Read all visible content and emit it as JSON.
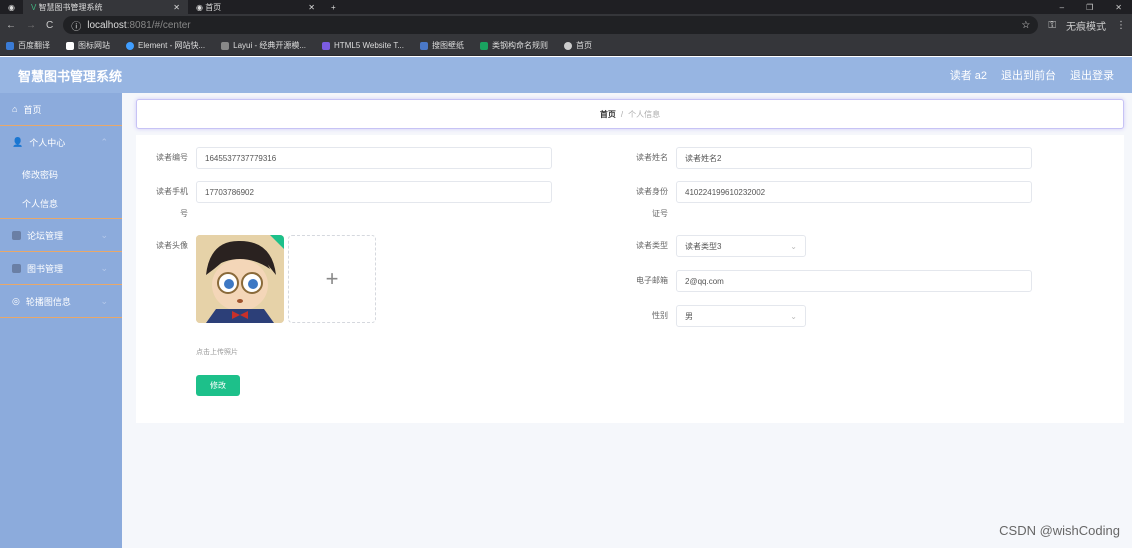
{
  "browser": {
    "tabs": [
      {
        "title": "智慧图书管理系统"
      },
      {
        "title": "首页"
      }
    ],
    "url_host": "localhost",
    "url_rest": ":8081/#/center",
    "profile": "无痕模式",
    "bookmarks": [
      "百度翻译",
      "图标网站",
      "Element - 网站快...",
      "Layui - 经典开源模...",
      "HTML5 Website T...",
      "搜图壁纸",
      "类钢构命名规则",
      "首页"
    ]
  },
  "header": {
    "title": "智慧图书管理系统",
    "user": "读者 a2",
    "to_front": "退出到前台",
    "logout": "退出登录"
  },
  "sidebar": {
    "items": [
      {
        "label": "首页"
      },
      {
        "label": "个人中心"
      },
      {
        "label": "修改密码"
      },
      {
        "label": "个人信息"
      },
      {
        "label": "论坛管理"
      },
      {
        "label": "图书管理"
      },
      {
        "label": "轮播图信息"
      }
    ]
  },
  "breadcrumb": {
    "home": "首页",
    "sep": "/",
    "current": "个人信息"
  },
  "form": {
    "reader_no": {
      "label": "读者编号",
      "value": "1645537737779316"
    },
    "reader_name": {
      "label": "读者姓名",
      "value": "读者姓名2"
    },
    "phone": {
      "label1": "读者手机",
      "label2": "号",
      "value": "17703786902"
    },
    "id_card": {
      "label1": "读者身份",
      "label2": "证号",
      "value": "410224199610232002"
    },
    "avatar": {
      "label": "读者头像",
      "hint": "点击上传照片"
    },
    "reader_type": {
      "label": "读者类型",
      "value": "读者类型3"
    },
    "email": {
      "label": "电子邮箱",
      "value": "2@qq.com"
    },
    "gender": {
      "label": "性别",
      "value": "男"
    },
    "submit": "修改"
  },
  "watermark": "CSDN @wishCoding"
}
